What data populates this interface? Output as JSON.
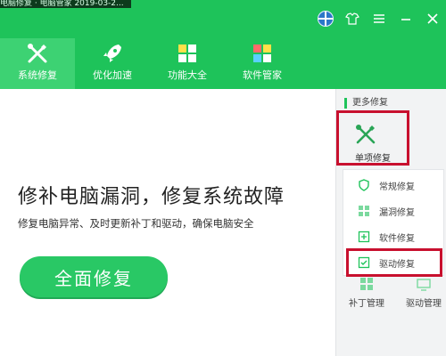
{
  "window": {
    "caption": "电脑修复 · 电脑管家 2019-03-2..."
  },
  "tabs": [
    {
      "label": "系统修复",
      "icon": "wrench-screwdriver-icon"
    },
    {
      "label": "优化加速",
      "icon": "rocket-icon"
    },
    {
      "label": "功能大全",
      "icon": "grid-icon"
    },
    {
      "label": "软件管家",
      "icon": "apps-icon"
    }
  ],
  "main": {
    "headline": "修补电脑漏洞，修复系统故障",
    "subtitle": "修复电脑异常、及时更新补丁和驱动，确保电脑安全",
    "primary_button": "全面修复"
  },
  "sidebar": {
    "title": "更多修复",
    "single": {
      "label": "单项修复",
      "icon": "wrench-screwdriver-icon"
    },
    "items": [
      {
        "label": "常规修复",
        "icon": "shield-icon"
      },
      {
        "label": "漏洞修复",
        "icon": "windows-icon"
      },
      {
        "label": "软件修复",
        "icon": "plus-box-icon"
      },
      {
        "label": "驱动修复",
        "icon": "check-box-icon"
      }
    ],
    "bottom": [
      {
        "label": "补丁管理",
        "icon": "patch-icon"
      },
      {
        "label": "驱动管理",
        "icon": "driver-icon"
      }
    ]
  },
  "colors": {
    "brand_green": "#1ec35a",
    "active_tab": "#3dd273",
    "highlight_red": "#c8102e"
  }
}
